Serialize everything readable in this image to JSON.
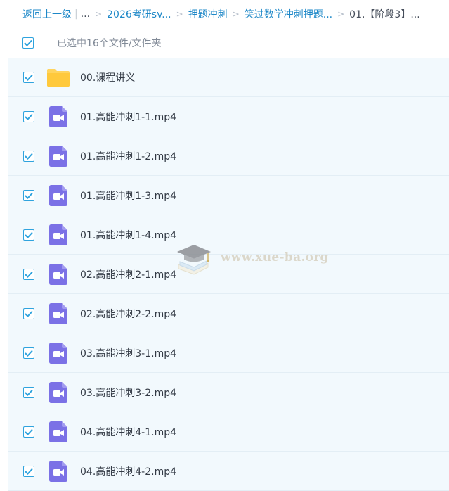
{
  "breadcrumb": {
    "back": "返回上一级",
    "pipe": "|",
    "ellipsis": "...",
    "items": [
      {
        "label": "2026考研sv..."
      },
      {
        "label": "押题冲刺"
      },
      {
        "label": "笑过数学冲刺押题..."
      },
      {
        "label": "01.【阶段3】..."
      }
    ],
    "separator": ">"
  },
  "selection": {
    "text": "已选中16个文件/文件夹",
    "checked": true
  },
  "files": [
    {
      "name": "00.课程讲义",
      "icon": "folder-icon",
      "checked": true
    },
    {
      "name": "01.高能冲刺1-1.mp4",
      "icon": "video-file-icon",
      "checked": true
    },
    {
      "name": "01.高能冲刺1-2.mp4",
      "icon": "video-file-icon",
      "checked": true
    },
    {
      "name": "01.高能冲刺1-3.mp4",
      "icon": "video-file-icon",
      "checked": true
    },
    {
      "name": "01.高能冲刺1-4.mp4",
      "icon": "video-file-icon",
      "checked": true
    },
    {
      "name": "02.高能冲刺2-1.mp4",
      "icon": "video-file-icon",
      "checked": true
    },
    {
      "name": "02.高能冲刺2-2.mp4",
      "icon": "video-file-icon",
      "checked": true
    },
    {
      "name": "03.高能冲刺3-1.mp4",
      "icon": "video-file-icon",
      "checked": true
    },
    {
      "name": "03.高能冲刺3-2.mp4",
      "icon": "video-file-icon",
      "checked": true
    },
    {
      "name": "04.高能冲刺4-1.mp4",
      "icon": "video-file-icon",
      "checked": true
    },
    {
      "name": "04.高能冲刺4-2.mp4",
      "icon": "video-file-icon",
      "checked": true
    }
  ],
  "watermark": {
    "text": "www.xue-ba.org",
    "icon": "graduation-cap-icon"
  },
  "colors": {
    "link": "#1e88c8",
    "checkbox": "#2fa3de",
    "row_background": "#f2f9fd",
    "folder": "#ffd45e",
    "video_icon": "#7b71e6"
  }
}
